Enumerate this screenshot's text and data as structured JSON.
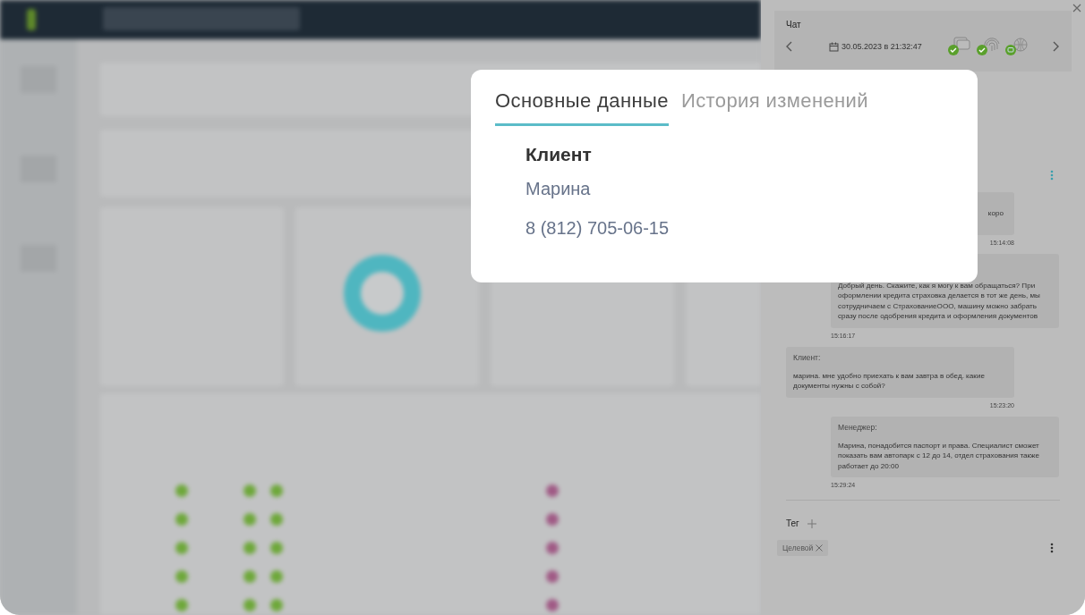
{
  "popup": {
    "tabs": [
      {
        "label": "Основные данные",
        "selected": true
      },
      {
        "label": "История изменений",
        "selected": false
      }
    ],
    "client": {
      "heading": "Клиент",
      "name": "Марина",
      "phone": "8 (812) 705-06-15"
    }
  },
  "chat": {
    "title": "Чат",
    "datetime": "30.05.2023 в 21:32:47",
    "channels": [
      {
        "kind": "messages"
      },
      {
        "kind": "fingerprint"
      },
      {
        "kind": "web"
      }
    ],
    "messages": [
      {
        "kind": "incoming",
        "text": "коро",
        "time": "15:14:08"
      },
      {
        "kind": "outgoing",
        "text": "Добрый день. Скажите, как я могу к вам обращаться? При оформлении кредита страховка делается в тот же день, мы сотрудничаем с СтрахованиеООО, машину можно забрать сразу после одобрения кредита и оформления документов",
        "time": "15:16:17"
      },
      {
        "kind": "incoming",
        "author": "Клиент:",
        "text": "марина. мне удобно приехать к вам завтра в обед. какие документы нужны с собой?",
        "time": "15:23:20"
      },
      {
        "kind": "outgoing",
        "author": "Менеджер:",
        "text": "Марина, понадобится паспорт и права. Специалист сможет показать вам автопарк с 12 до 14, отдел страхования также работает до 20:00",
        "time": "15:29:24"
      }
    ],
    "tag_label": "Тег",
    "tags": [
      "Целевой"
    ]
  }
}
